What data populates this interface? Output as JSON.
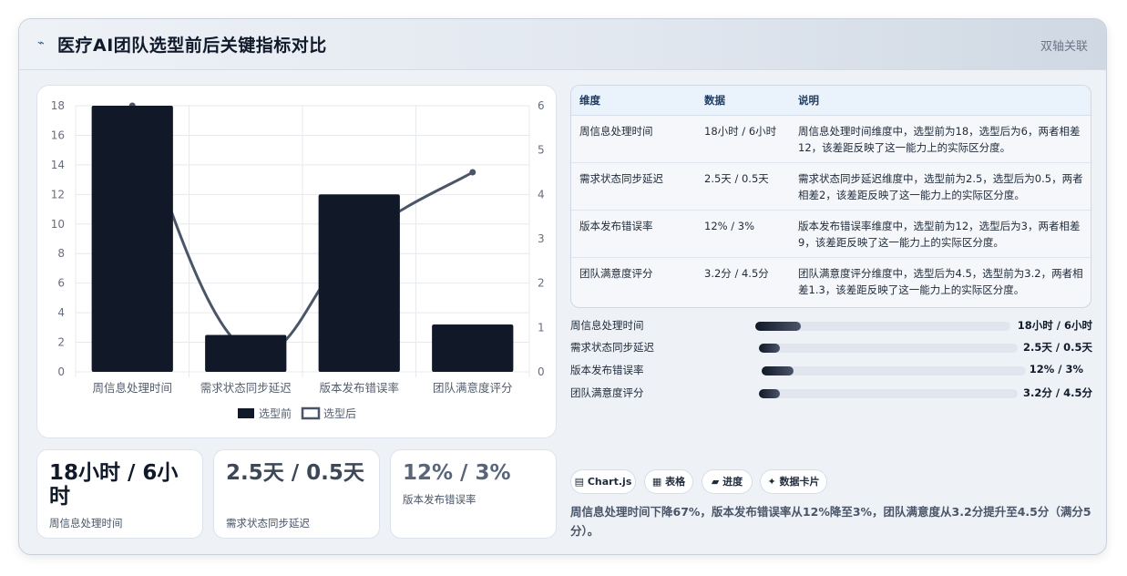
{
  "header": {
    "icon": "trend-line-icon",
    "title": "医疗AI团队选型前后关键指标对比",
    "tag": "双轴关联"
  },
  "chart_data": {
    "type": "bar",
    "categories": [
      "周信息处理时间",
      "需求状态同步延迟",
      "版本发布错误率",
      "团队满意度评分"
    ],
    "series": [
      {
        "name": "选型前",
        "chart": "bar",
        "axis": "left",
        "values": [
          18,
          2.5,
          12,
          3.2
        ],
        "color": "#111827"
      },
      {
        "name": "选型后",
        "chart": "line",
        "axis": "right",
        "values": [
          6,
          0.5,
          3,
          4.5
        ],
        "color": "#4a5568"
      }
    ],
    "y_left": {
      "ylim": [
        0,
        18
      ],
      "ticks": [
        0,
        2,
        4,
        6,
        8,
        10,
        12,
        14,
        16,
        18
      ]
    },
    "y_right": {
      "ylim": [
        0,
        6
      ],
      "ticks": [
        0,
        1,
        2,
        3,
        4,
        5,
        6
      ]
    },
    "grid": true,
    "legend": "bottom"
  },
  "stats": [
    {
      "value": "18小时 / 6小时",
      "label": "周信息处理时间",
      "color": "#111a2b"
    },
    {
      "value": "2.5天 / 0.5天",
      "label": "需求状态同步延迟",
      "color": "#3c4758"
    },
    {
      "value": "12% / 3%",
      "label": "版本发布错误率",
      "color": "#58657a"
    }
  ],
  "table": {
    "headers": [
      "维度",
      "数据",
      "说明"
    ],
    "rows": [
      [
        "周信息处理时间",
        "18小时 / 6小时",
        "周信息处理时间维度中，选型前为18，选型后为6，两者相差12，该差距反映了这一能力上的实际区分度。"
      ],
      [
        "需求状态同步延迟",
        "2.5天 / 0.5天",
        "需求状态同步延迟维度中，选型前为2.5，选型后为0.5，两者相差2，该差距反映了这一能力上的实际区分度。"
      ],
      [
        "版本发布错误率",
        "12% / 3%",
        "版本发布错误率维度中，选型前为12，选型后为3，两者相差9，该差距反映了这一能力上的实际区分度。"
      ],
      [
        "团队满意度评分",
        "3.2分 / 4.5分",
        "团队满意度评分维度中，选型后为4.5，选型前为3.2，两者相差1.3，该差距反映了这一能力上的实际区分度。"
      ]
    ]
  },
  "progress": [
    {
      "label": "周信息处理时间",
      "value": "18小时 / 6小时",
      "fraction": 0.18
    },
    {
      "label": "需求状态同步延迟",
      "value": "2.5天 / 0.5天",
      "fraction": 0.08
    },
    {
      "label": "版本发布错误率",
      "value": "12% / 3%",
      "fraction": 0.12
    },
    {
      "label": "团队满意度评分",
      "value": "3.2分 / 4.5分",
      "fraction": 0.08
    }
  ],
  "chips": [
    {
      "icon": "chart-icon",
      "glyph": "▤",
      "label": "Chart.js"
    },
    {
      "icon": "table-icon",
      "glyph": "▦",
      "label": "表格"
    },
    {
      "icon": "progress-icon",
      "glyph": "▰",
      "label": "进度"
    },
    {
      "icon": "sparkle-icon",
      "glyph": "✦",
      "label": "数据卡片"
    }
  ],
  "summary": "周信息处理时间下降67%，版本发布错误率从12%降至3%，团队满意度从3.2分提升至4.5分（满分5分）。"
}
